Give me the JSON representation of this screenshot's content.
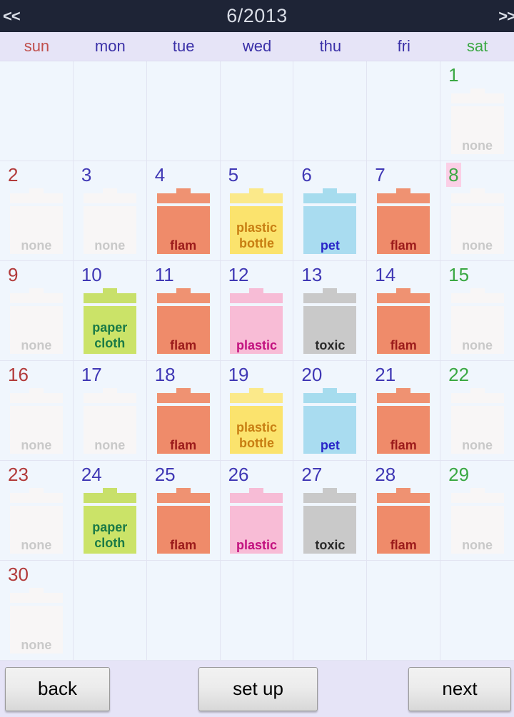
{
  "titlebar": {
    "prev_label": "<<",
    "month_label": "6/2013",
    "next_label": ">>"
  },
  "weekdays": [
    {
      "label": "sun",
      "kind": "sun"
    },
    {
      "label": "mon",
      "kind": "weekday"
    },
    {
      "label": "tue",
      "kind": "weekday"
    },
    {
      "label": "wed",
      "kind": "weekday"
    },
    {
      "label": "thu",
      "kind": "weekday"
    },
    {
      "label": "fri",
      "kind": "weekday"
    },
    {
      "label": "sat",
      "kind": "sat"
    }
  ],
  "colors": {
    "titlebar_bg": "#1e2436",
    "titlebar_text": "#d9dde6",
    "header_bg": "#e6e4f7",
    "grid_bg": "#f0f6fd",
    "sun_text": "#b23a3a",
    "weekday_text": "#4038b5",
    "sat_text": "#3aa843",
    "today_highlight": "#fbcfe6",
    "bottom_bar_bg": "#e6e4f7"
  },
  "bin_types": {
    "flam": {
      "label": "flam",
      "lid": "#ef9272",
      "body": "#ef8b6a",
      "text": "#9c1b1b"
    },
    "plastic_bottle": {
      "label": "plastic\nbottle",
      "lid": "#fbe98a",
      "body": "#fbe36d",
      "text": "#c87e12"
    },
    "pet": {
      "label": "pet",
      "lid": "#a6dcee",
      "body": "#a9dcf0",
      "text": "#2a26c8"
    },
    "paper_cloth": {
      "label": "paper\ncloth",
      "lid": "#c8e06a",
      "body": "#cbe368",
      "text": "#1a7a46"
    },
    "plastic": {
      "label": "plastic",
      "lid": "#f7bcd6",
      "body": "#f8bcd6",
      "text": "#c2117f"
    },
    "toxic": {
      "label": "toxic",
      "lid": "#c9c9c9",
      "body": "#c9c9c9",
      "text": "#2b2b2b"
    },
    "none": {
      "label": "none",
      "lid": "#f8f6f6",
      "body": "#f8f6f6",
      "text": "#c9c9c9"
    }
  },
  "days": [
    {
      "num": "",
      "kind": "empty",
      "bin": null,
      "today": false
    },
    {
      "num": "",
      "kind": "empty",
      "bin": null,
      "today": false
    },
    {
      "num": "",
      "kind": "empty",
      "bin": null,
      "today": false
    },
    {
      "num": "",
      "kind": "empty",
      "bin": null,
      "today": false
    },
    {
      "num": "",
      "kind": "empty",
      "bin": null,
      "today": false
    },
    {
      "num": "",
      "kind": "empty",
      "bin": null,
      "today": false
    },
    {
      "num": "1",
      "kind": "sat",
      "bin": "none",
      "today": false
    },
    {
      "num": "2",
      "kind": "sun",
      "bin": "none",
      "today": false
    },
    {
      "num": "3",
      "kind": "weekday",
      "bin": "none",
      "today": false
    },
    {
      "num": "4",
      "kind": "weekday",
      "bin": "flam",
      "today": false
    },
    {
      "num": "5",
      "kind": "weekday",
      "bin": "plastic_bottle",
      "today": false
    },
    {
      "num": "6",
      "kind": "weekday",
      "bin": "pet",
      "today": false
    },
    {
      "num": "7",
      "kind": "weekday",
      "bin": "flam",
      "today": false
    },
    {
      "num": "8",
      "kind": "sat",
      "bin": "none",
      "today": true
    },
    {
      "num": "9",
      "kind": "sun",
      "bin": "none",
      "today": false
    },
    {
      "num": "10",
      "kind": "weekday",
      "bin": "paper_cloth",
      "today": false
    },
    {
      "num": "11",
      "kind": "weekday",
      "bin": "flam",
      "today": false
    },
    {
      "num": "12",
      "kind": "weekday",
      "bin": "plastic",
      "today": false
    },
    {
      "num": "13",
      "kind": "weekday",
      "bin": "toxic",
      "today": false
    },
    {
      "num": "14",
      "kind": "weekday",
      "bin": "flam",
      "today": false
    },
    {
      "num": "15",
      "kind": "sat",
      "bin": "none",
      "today": false
    },
    {
      "num": "16",
      "kind": "sun",
      "bin": "none",
      "today": false
    },
    {
      "num": "17",
      "kind": "weekday",
      "bin": "none",
      "today": false
    },
    {
      "num": "18",
      "kind": "weekday",
      "bin": "flam",
      "today": false
    },
    {
      "num": "19",
      "kind": "weekday",
      "bin": "plastic_bottle",
      "today": false
    },
    {
      "num": "20",
      "kind": "weekday",
      "bin": "pet",
      "today": false
    },
    {
      "num": "21",
      "kind": "weekday",
      "bin": "flam",
      "today": false
    },
    {
      "num": "22",
      "kind": "sat",
      "bin": "none",
      "today": false
    },
    {
      "num": "23",
      "kind": "sun",
      "bin": "none",
      "today": false
    },
    {
      "num": "24",
      "kind": "weekday",
      "bin": "paper_cloth",
      "today": false
    },
    {
      "num": "25",
      "kind": "weekday",
      "bin": "flam",
      "today": false
    },
    {
      "num": "26",
      "kind": "weekday",
      "bin": "plastic",
      "today": false
    },
    {
      "num": "27",
      "kind": "weekday",
      "bin": "toxic",
      "today": false
    },
    {
      "num": "28",
      "kind": "weekday",
      "bin": "flam",
      "today": false
    },
    {
      "num": "29",
      "kind": "sat",
      "bin": "none",
      "today": false
    },
    {
      "num": "30",
      "kind": "sun",
      "bin": "none",
      "today": false
    },
    {
      "num": "",
      "kind": "empty",
      "bin": null,
      "today": false
    },
    {
      "num": "",
      "kind": "empty",
      "bin": null,
      "today": false
    },
    {
      "num": "",
      "kind": "empty",
      "bin": null,
      "today": false
    },
    {
      "num": "",
      "kind": "empty",
      "bin": null,
      "today": false
    },
    {
      "num": "",
      "kind": "empty",
      "bin": null,
      "today": false
    },
    {
      "num": "",
      "kind": "empty",
      "bin": null,
      "today": false
    }
  ],
  "bottombar": {
    "back_label": "back",
    "setup_label": "set up",
    "next_label": "next"
  }
}
